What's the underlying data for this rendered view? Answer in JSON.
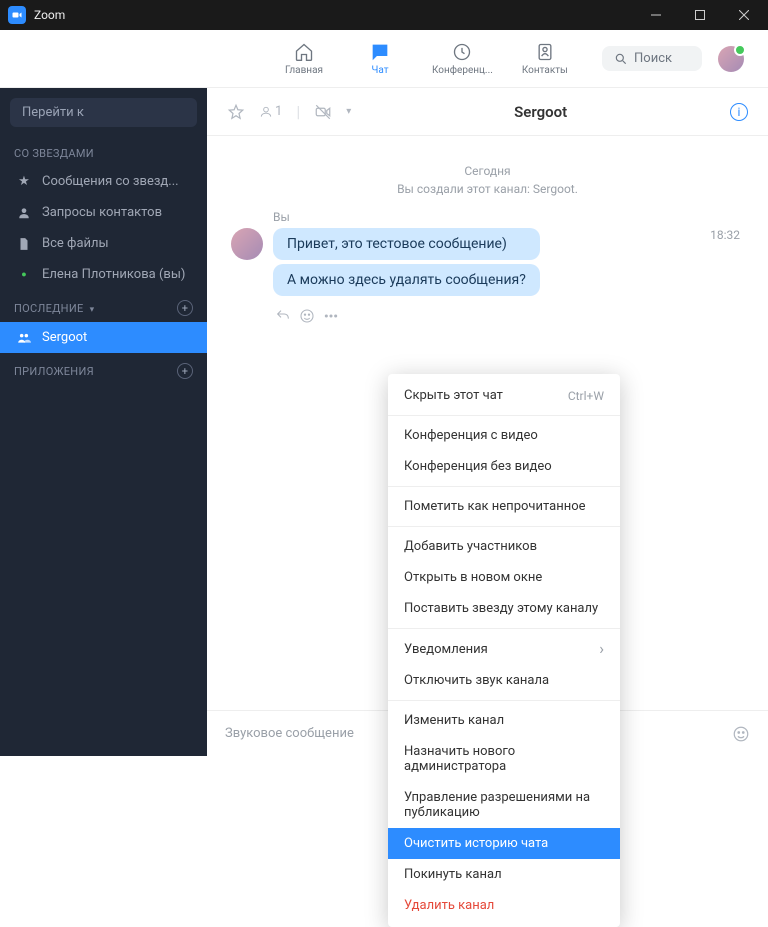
{
  "window": {
    "title": "Zoom"
  },
  "nav": {
    "home": "Главная",
    "chat": "Чат",
    "conf": "Конференц...",
    "contacts": "Контакты"
  },
  "search": {
    "placeholder": "Поиск"
  },
  "sidebar": {
    "goto": "Перейти к",
    "sections": {
      "starred": "СО ЗВЕЗДАМИ",
      "recent": "ПОСЛЕДНИЕ",
      "apps": "ПРИЛОЖЕНИЯ"
    },
    "starred_items": [
      {
        "label": "Сообщения со звезд..."
      },
      {
        "label": "Запросы контактов"
      },
      {
        "label": "Все файлы"
      },
      {
        "label": "Елена Плотникова (вы)"
      }
    ],
    "recent_items": [
      {
        "label": "Sergoot"
      }
    ]
  },
  "chat": {
    "title": "Sergoot",
    "members": "1",
    "day": "Сегодня",
    "system": "Вы создали этот канал: Sergoot.",
    "author": "Вы",
    "time": "18:32",
    "messages": [
      "Привет, это тестовое сообщение)",
      "А можно здесь удалять сообщения?"
    ],
    "input_placeholder": "Звуковое сообщение"
  },
  "context_menu": {
    "hide": "Скрыть этот чат",
    "hide_shortcut": "Ctrl+W",
    "conf_video": "Конференция с видео",
    "conf_novideo": "Конференция без видео",
    "mark_unread": "Пометить как непрочитанное",
    "add_members": "Добавить участников",
    "open_new_window": "Открыть в новом окне",
    "star_channel": "Поставить звезду этому каналу",
    "notifications": "Уведомления",
    "mute": "Отключить звук канала",
    "edit_channel": "Изменить канал",
    "assign_admin": "Назначить нового администратора",
    "manage_perms": "Управление разрешениями на публикацию",
    "clear_history": "Очистить историю чата",
    "leave": "Покинуть канал",
    "delete": "Удалить канал"
  }
}
